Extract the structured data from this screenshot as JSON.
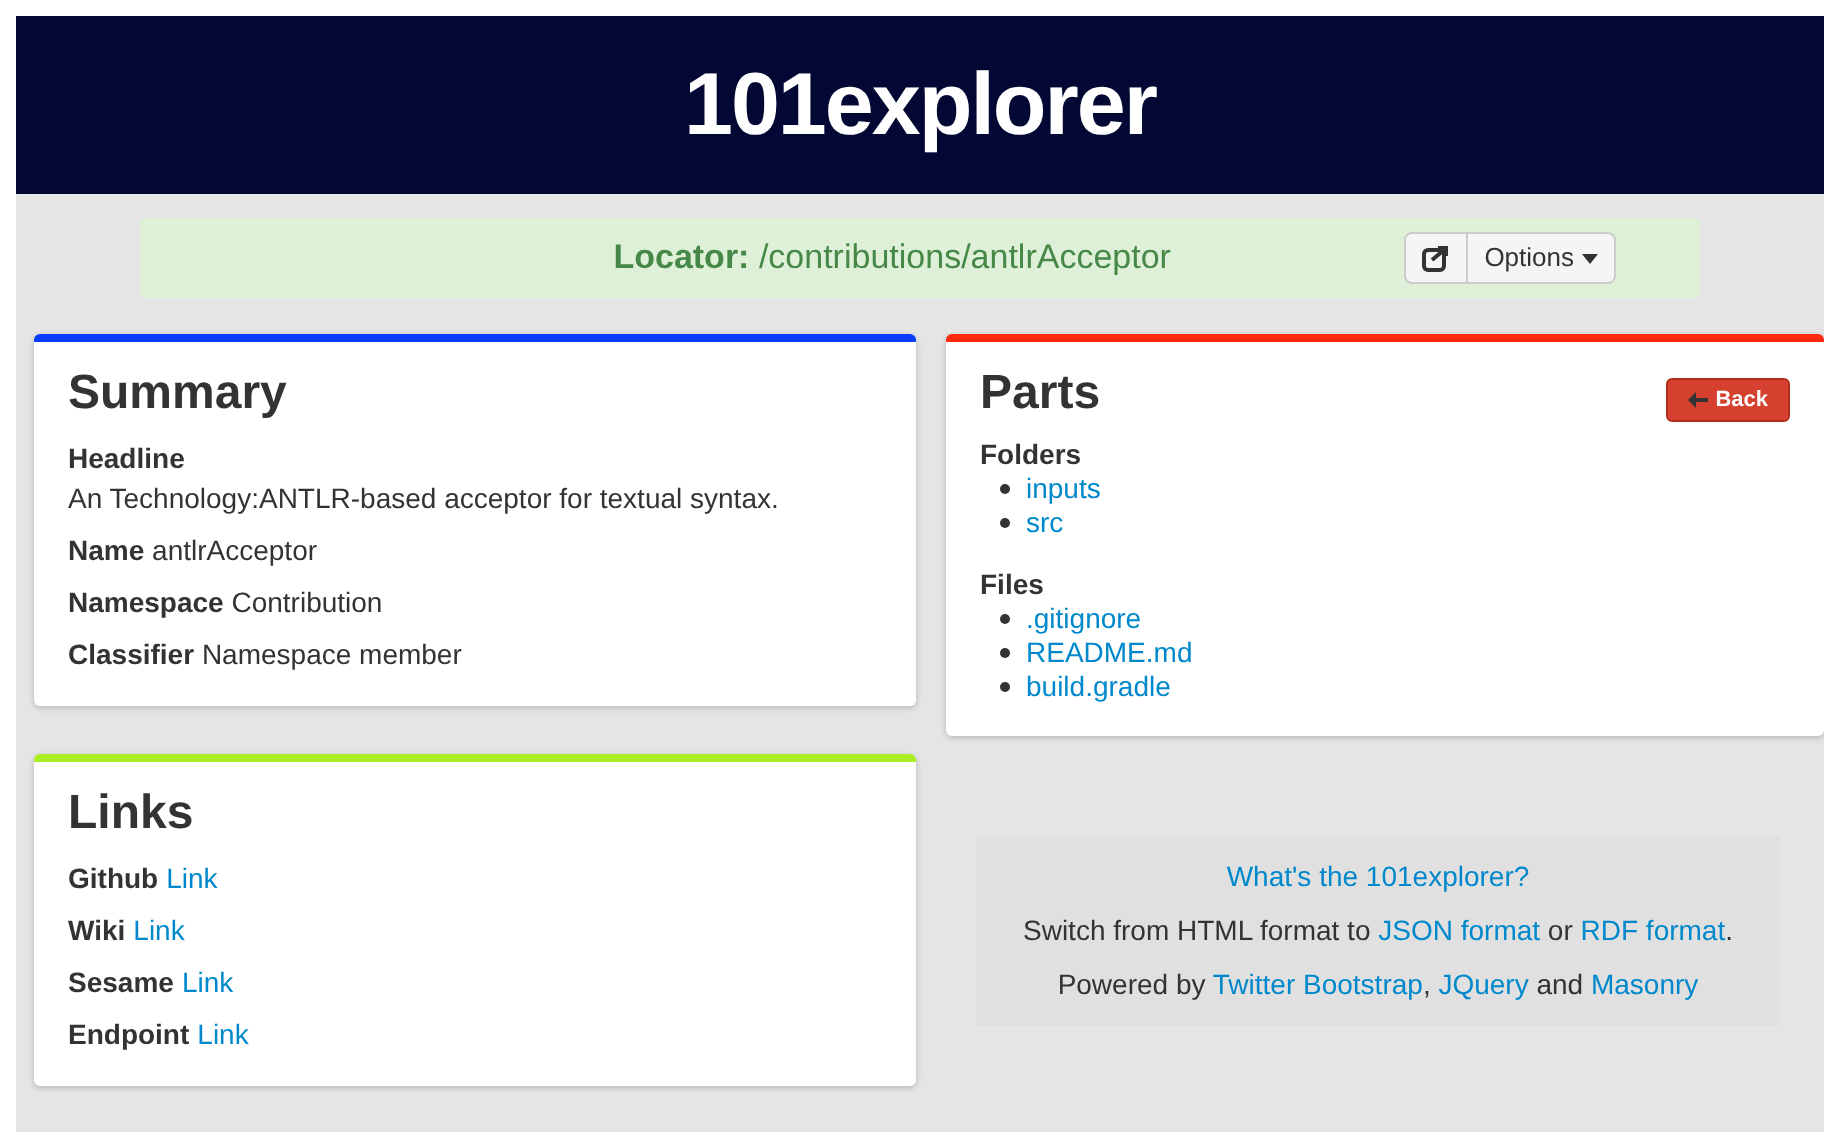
{
  "header": {
    "title": "101explorer"
  },
  "locator": {
    "label": "Locator:",
    "path": "/contributions/antlrAcceptor",
    "options_label": "Options"
  },
  "summary": {
    "title": "Summary",
    "color": "#0a3cff",
    "fields": [
      {
        "label": "Headline",
        "value": "An Technology:ANTLR-based acceptor for textual syntax.",
        "kind": "block"
      },
      {
        "label": "Name",
        "value": "antlrAcceptor",
        "kind": "inline"
      },
      {
        "label": "Namespace",
        "value": "Contribution",
        "kind": "inline"
      },
      {
        "label": "Classifier",
        "value": "Namespace member",
        "kind": "inline"
      }
    ]
  },
  "links": {
    "title": "Links",
    "color": "#aaee22",
    "items": [
      {
        "label": "Github",
        "link": "Link"
      },
      {
        "label": "Wiki",
        "link": "Link"
      },
      {
        "label": "Sesame",
        "link": "Link"
      },
      {
        "label": "Endpoint",
        "link": "Link"
      }
    ]
  },
  "parts": {
    "title": "Parts",
    "color": "#ff2a10",
    "back_label": "Back",
    "groups": [
      {
        "title": "Folders",
        "items": [
          "inputs",
          "src"
        ]
      },
      {
        "title": "Files",
        "items": [
          ".gitignore",
          "README.md",
          "build.gradle"
        ]
      }
    ]
  },
  "footer": {
    "lines": [
      [
        {
          "kind": "link",
          "text": "What's the 101explorer?"
        }
      ],
      [
        {
          "kind": "text",
          "text": "Switch from HTML format to "
        },
        {
          "kind": "link",
          "text": "JSON format"
        },
        {
          "kind": "text",
          "text": " or "
        },
        {
          "kind": "link",
          "text": "RDF format"
        },
        {
          "kind": "text",
          "text": "."
        }
      ],
      [
        {
          "kind": "text",
          "text": "Powered by "
        },
        {
          "kind": "link",
          "text": "Twitter Bootstrap",
          "suffix": ", "
        },
        {
          "kind": "link",
          "text": "JQuery"
        },
        {
          "kind": "text",
          "text": " and "
        },
        {
          "kind": "link",
          "text": "Masonry"
        }
      ]
    ]
  }
}
